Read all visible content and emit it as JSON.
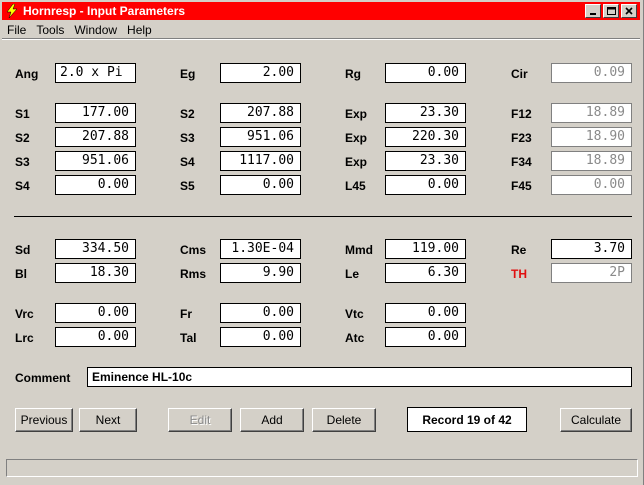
{
  "window": {
    "title": "Hornresp - Input Parameters",
    "controls": {
      "minimize": "_",
      "maximize": "□",
      "close": "×"
    }
  },
  "menu": [
    "File",
    "Tools",
    "Window",
    "Help"
  ],
  "labels": {
    "ang": "Ang",
    "eg": "Eg",
    "rg": "Rg",
    "cir": "Cir",
    "s1": "S1",
    "s2a": "S2",
    "exp1": "Exp",
    "f12": "F12",
    "s2b": "S2",
    "s3a": "S3",
    "exp2": "Exp",
    "f23": "F23",
    "s3b": "S3",
    "s4a": "S4",
    "exp3": "Exp",
    "f34": "F34",
    "s4b": "S4",
    "s5": "S5",
    "l45": "L45",
    "f45": "F45",
    "sd": "Sd",
    "cms": "Cms",
    "mmd": "Mmd",
    "re": "Re",
    "bl": "Bl",
    "rms": "Rms",
    "le": "Le",
    "th": "TH",
    "vrc": "Vrc",
    "fr": "Fr",
    "vtc": "Vtc",
    "lrc": "Lrc",
    "tal": "Tal",
    "atc": "Atc",
    "comment": "Comment"
  },
  "values": {
    "ang": "2.0 x Pi",
    "eg": "2.00",
    "rg": "0.00",
    "cir": "0.09",
    "s1": "177.00",
    "s2a": "207.88",
    "exp1": "23.30",
    "f12": "18.89",
    "s2b": "207.88",
    "s3a": "951.06",
    "exp2": "220.30",
    "f23": "18.90",
    "s3b": "951.06",
    "s4a": "1117.00",
    "exp3": "23.30",
    "f34": "18.89",
    "s4b": "0.00",
    "s5": "0.00",
    "l45": "0.00",
    "f45": "0.00",
    "sd": "334.50",
    "cms": "1.30E-04",
    "mmd": "119.00",
    "re": "3.70",
    "bl": "18.30",
    "rms": "9.90",
    "le": "6.30",
    "th": "2P",
    "vrc": "0.00",
    "fr": "0.00",
    "vtc": "0.00",
    "lrc": "0.00",
    "tal": "0.00",
    "atc": "0.00",
    "comment": "Eminence HL-10c"
  },
  "buttons": {
    "previous": "Previous",
    "next": "Next",
    "edit": "Edit",
    "add": "Add",
    "delete": "Delete",
    "calculate": "Calculate"
  },
  "record": "Record 19 of 42",
  "colors": {
    "titlebar": "#ff0000",
    "th_label": "#e01010",
    "readonly_text": "#8a8a8a"
  },
  "icons": {
    "app": "lightning-icon"
  }
}
